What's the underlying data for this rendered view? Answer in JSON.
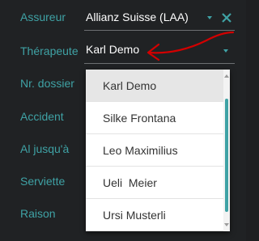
{
  "fields": [
    {
      "label": "Assureur",
      "value": "Allianz Suisse (LAA)"
    },
    {
      "label": "Thérapeute",
      "value": "Karl Demo"
    },
    {
      "label": "Nr. dossier"
    },
    {
      "label": "Accident"
    },
    {
      "label": "Al jusqu'à"
    },
    {
      "label": "Serviette"
    },
    {
      "label": "Raison"
    }
  ],
  "therapist_dropdown": {
    "options": [
      "Karl Demo",
      "Silke Frontana",
      "Leo Maximilius",
      "Ueli  Meier",
      "Ursi Musterli"
    ],
    "selected": "Karl Demo"
  },
  "colors": {
    "accent": "#3fa2a5",
    "annotation": "#d20000",
    "background": "#202224"
  },
  "icons": {
    "clear": "close-icon",
    "expand": "chevron-down-icon"
  }
}
